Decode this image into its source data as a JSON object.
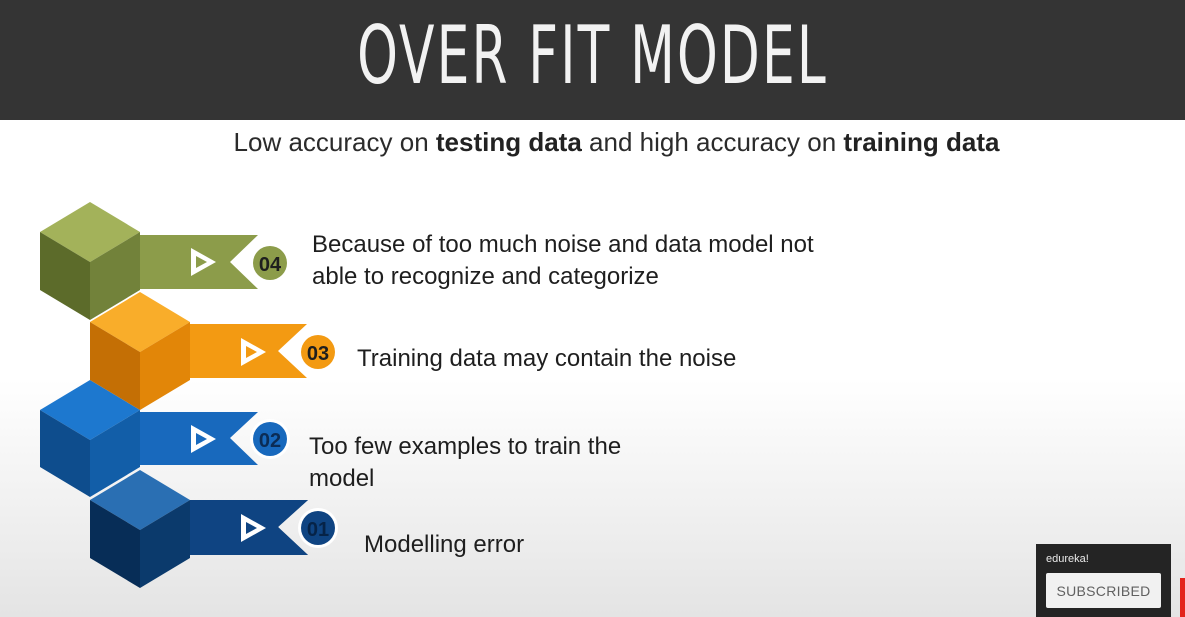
{
  "slide": {
    "title": "OVER FIT MODEL",
    "subtitle": {
      "part1": "Low accuracy on ",
      "bold1": "testing data",
      "part2": " and high accuracy on ",
      "bold2": "training data"
    },
    "steps": [
      {
        "number": "04",
        "text_line1": "Because of too much noise and data model not",
        "text_line2": "able to recognize and categorize",
        "color": "#8a9a48"
      },
      {
        "number": "03",
        "text_line1": "Training data may contain the noise",
        "color": "#f0960f"
      },
      {
        "number": "02",
        "text_line1": "Too few examples to train the",
        "text_line2": "model",
        "color": "#1565b7"
      },
      {
        "number": "01",
        "text_line1": "Modelling error",
        "color": "#0e3f78"
      }
    ]
  },
  "overlay": {
    "channel": "edureka!",
    "subscribe_label": "SUBSCRIBED"
  }
}
